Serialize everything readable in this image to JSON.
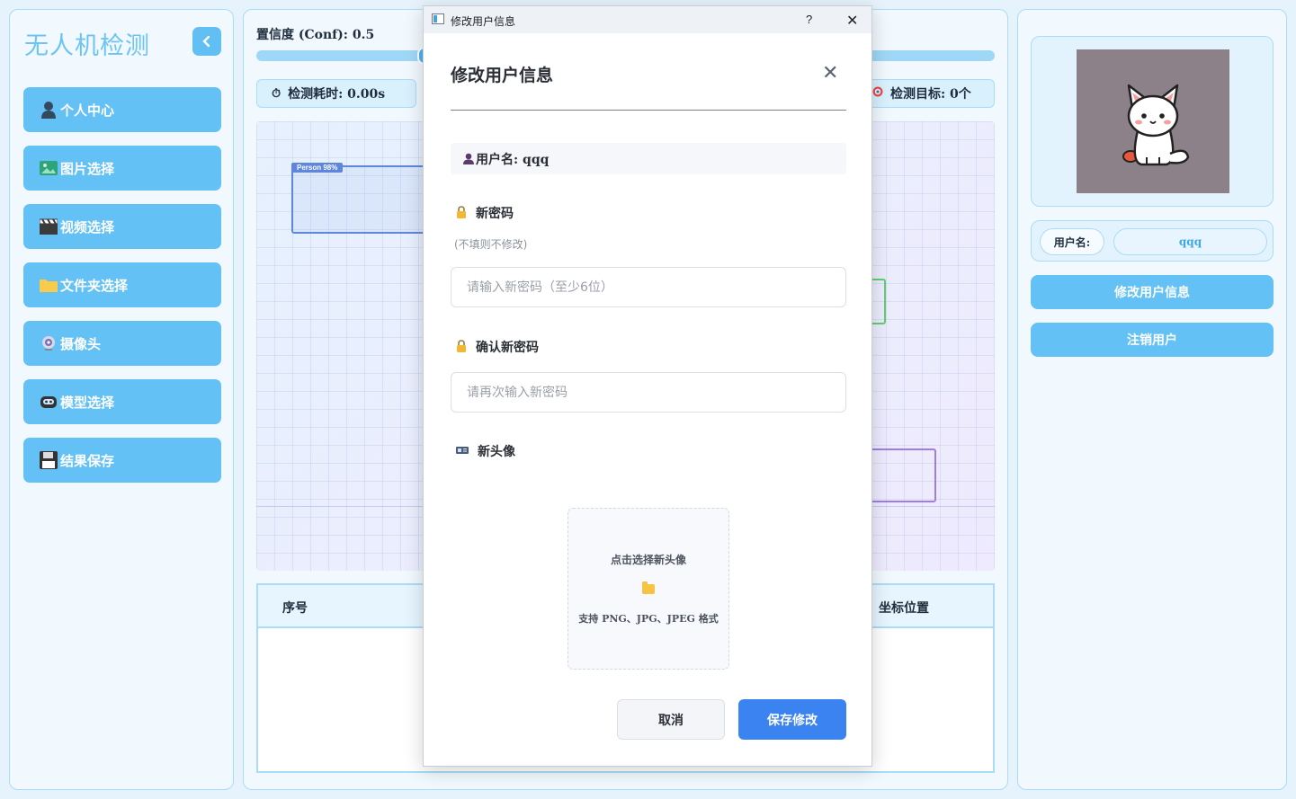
{
  "sidebar": {
    "title": "无人机检测",
    "items": [
      {
        "label": "个人中心",
        "icon": "user-icon"
      },
      {
        "label": " 图片选择",
        "icon": "image-icon"
      },
      {
        "label": "视频选择",
        "icon": "clapper-icon"
      },
      {
        "label": "文件夹选择",
        "icon": "folder-icon"
      },
      {
        "label": "摄像头",
        "icon": "webcam-icon"
      },
      {
        "label": "模型选择",
        "icon": "robot-icon"
      },
      {
        "label": "结果保存",
        "icon": "floppy-icon"
      }
    ]
  },
  "main": {
    "conf_label": "置信度 (Conf): 0.5",
    "conf_value": 0.5,
    "time_label": "检测耗时: 0.00s",
    "targets_label": "检测目标: 0个",
    "bbox_label": "Person 98%",
    "table": {
      "headers": [
        "序号",
        "坐标位置"
      ]
    }
  },
  "right": {
    "username_label": "用户名:",
    "username_value": "qqq",
    "edit_button": "修改用户信息",
    "logout_button": "注销用户"
  },
  "dialog": {
    "window_title": "修改用户信息",
    "help": "?",
    "title": "修改用户信息",
    "username_line": "用户名: qqq",
    "new_password_label": "新密码",
    "new_password_hint": "(不填则不修改)",
    "new_password_placeholder": "请输入新密码（至少6位）",
    "confirm_password_label": "确认新密码",
    "confirm_password_placeholder": "请再次输入新密码",
    "avatar_label": "新头像",
    "upload_text": "点击选择新头像",
    "upload_formats": "支持 PNG、JPG、JPEG 格式",
    "cancel": "取消",
    "save": "保存修改"
  },
  "colors": {
    "accent": "#63c1f6",
    "primary_button": "#3b83f0"
  }
}
